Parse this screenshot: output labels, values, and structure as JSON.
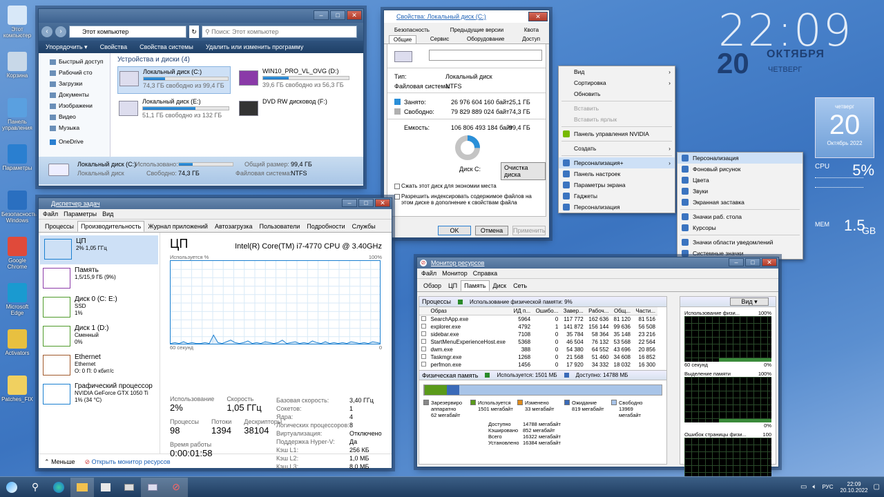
{
  "desktop": {
    "icons": [
      "Этот компьютер",
      "Корзина",
      "Панель управления",
      "Параметры",
      "Безопасность Windows",
      "Google Chrome",
      "Microsoft Edge",
      "Activators",
      "Patches_FIX"
    ]
  },
  "clock": {
    "time": "22:09",
    "day": "20",
    "month": "ОКТЯБРЯ",
    "weekday": "ЧЕТВЕРГ"
  },
  "calendar": {
    "weekday": "четверг",
    "day": "20",
    "month": "Октябрь 2022"
  },
  "gadget": {
    "cpu_label": "CPU",
    "cpu_value": "5%",
    "mem_label": "МЕМ",
    "mem_value": "1.5",
    "mem_unit": "GB"
  },
  "explorer": {
    "address": "Этот компьютер",
    "search_placeholder": "Поиск: Этот компьютер",
    "toolbar": [
      "Упорядочить ▾",
      "Свойства",
      "Свойства системы",
      "Удалить или изменить программу"
    ],
    "nav": [
      "Быстрый доступ",
      "Рабочий сто",
      "Загрузки",
      "Документы",
      "Изображени",
      "Видео",
      "Музыка",
      "OneDrive"
    ],
    "group": "Устройства и диски (4)",
    "drives": [
      {
        "name": "Локальный диск (C:)",
        "free": "74,3 ГБ свободно из 99,4 ГБ",
        "fill": 0.25
      },
      {
        "name": "WIN10_PRO_VL_OVG (D:)",
        "free": "39,6 ГБ свободно из 56,3 ГБ",
        "fill": 0.3
      },
      {
        "name": "Локальный диск (E:)",
        "free": "51,1 ГБ свободно из 132 ГБ",
        "fill": 0.61
      },
      {
        "name": "DVD RW дисковод (F:)",
        "free": "",
        "fill": 0
      }
    ],
    "details": {
      "name": "Локальный диск (C:)",
      "used_label": "Использовано:",
      "free_label": "Свободно:",
      "free": "74,3 ГБ",
      "total_label": "Общий размер:",
      "total": "99,4 ГБ",
      "fs_label": "Файловая система:",
      "fs": "NTFS",
      "kind": "Локальный диск"
    }
  },
  "props": {
    "title": "Свойства: Локальный диск (C:)",
    "tabs_top": [
      "Безопасность",
      "Предыдущие версии",
      "Квота"
    ],
    "tabs_bottom": [
      "Общие",
      "Сервис",
      "Оборудование",
      "Доступ"
    ],
    "type_label": "Тип:",
    "type": "Локальный диск",
    "fs_label": "Файловая система:",
    "fs": "NTFS",
    "used_label": "Занято:",
    "used_bytes": "26 976 604 160 байт",
    "used_gb": "25,1 ГБ",
    "free_label": "Свободно:",
    "free_bytes": "79 829 889 024 байт",
    "free_gb": "74,3 ГБ",
    "cap_label": "Емкость:",
    "cap_bytes": "106 806 493 184 байт",
    "cap_gb": "99,4 ГБ",
    "disk_label": "Диск C:",
    "cleanup": "Очистка диска",
    "compress": "Сжать этот диск для экономии места",
    "index": "Разрешить индексировать содержимое файлов на этом диске в дополнение к свойствам файла",
    "ok": "OK",
    "cancel": "Отмена",
    "apply": "Применить",
    "used_fraction": 0.253
  },
  "ctxmenu": {
    "items": [
      "Вид",
      "Сортировка",
      "Обновить",
      "Вставить",
      "Вставить ярлык",
      "Панель управления NVIDIA",
      "Создать",
      "Персонализация+",
      "Панель настроек",
      "Параметры экрана",
      "Гаджеты",
      "Персонализация"
    ],
    "sub": [
      "Персонализация",
      "Фоновый рисунок",
      "Цвета",
      "Звуки",
      "Экранная заставка",
      "Значки раб. стола",
      "Курсоры",
      "Значки области уведомлений",
      "Системные значки"
    ]
  },
  "taskmgr": {
    "title": "Диспетчер задач",
    "menu": [
      "Файл",
      "Параметры",
      "Вид"
    ],
    "tabs": [
      "Процессы",
      "Производительность",
      "Журнал приложений",
      "Автозагрузка",
      "Пользователи",
      "Подробности",
      "Службы"
    ],
    "side": [
      {
        "name": "ЦП",
        "sub": "2% 1,05 ГГц",
        "color": "#1a7fd0"
      },
      {
        "name": "Память",
        "sub": "1,5/15,9 ГБ (9%)",
        "color": "#8b3aa8"
      },
      {
        "name": "Диск 0 (C: E:)",
        "sub": "SSD\n1%",
        "color": "#4e9a2a"
      },
      {
        "name": "Диск 1 (D:)",
        "sub": "Сменный\n0%",
        "color": "#4e9a2a"
      },
      {
        "name": "Ethernet",
        "sub": "Ethernet\nО: 0 П: 0 кбит/с",
        "color": "#a0582a"
      },
      {
        "name": "Графический процессор",
        "sub": "NVIDIA GeForce GTX 1050 Ti\n1% (34 °C)",
        "color": "#1a7fd0"
      }
    ],
    "cpu_title": "ЦП",
    "cpu_model": "Intel(R) Core(TM) i7-4770 CPU @ 3.40GHz",
    "graph_label": "Используется %",
    "graph_max": "100%",
    "graph_time": "60 секунд",
    "graph_min": "0",
    "stats": {
      "usage_label": "Использование",
      "usage": "2%",
      "speed_label": "Скорость",
      "speed": "1,05 ГГц",
      "proc_label": "Процессы",
      "proc": "98",
      "threads_label": "Потоки",
      "threads": "1394",
      "handles_label": "Дескрипторы",
      "handles": "38104",
      "uptime_label": "Время работы",
      "uptime": "0:00:01:58"
    },
    "info": [
      [
        "Базовая скорость:",
        "3,40 ГГц"
      ],
      [
        "Сокетов:",
        "1"
      ],
      [
        "Ядра:",
        "4"
      ],
      [
        "Логических процессоров:",
        "8"
      ],
      [
        "Виртуализация:",
        "Отключено"
      ],
      [
        "Поддержка Hyper-V:",
        "Да"
      ],
      [
        "Кэш L1:",
        "256 КБ"
      ],
      [
        "Кэш L2:",
        "1,0 МБ"
      ],
      [
        "Кэш L3:",
        "8,0 МБ"
      ]
    ],
    "less": "Меньше",
    "open_monitor": "Открыть монитор ресурсов",
    "cpu_points": [
      2,
      3,
      2,
      4,
      2,
      3,
      2,
      2,
      3,
      2,
      12,
      3,
      2,
      4,
      6,
      3,
      2,
      3,
      5,
      2,
      3,
      2,
      4,
      3,
      2,
      3,
      6,
      2,
      3,
      4,
      2,
      3,
      2,
      5,
      3,
      2,
      4,
      2,
      3,
      2,
      3,
      2,
      4,
      3,
      2,
      3,
      2,
      4,
      3,
      2
    ]
  },
  "resmon": {
    "title": "Монитор ресурсов",
    "menu": [
      "Файл",
      "Монитор",
      "Справка"
    ],
    "tabs": [
      "Обзор",
      "ЦП",
      "Память",
      "Диск",
      "Сеть"
    ],
    "proc_header": "Процессы",
    "phys_usage": "Использование физической памяти: 9%",
    "cols": [
      "Образ",
      "ИД п...",
      "Ошибо...",
      "Завер...",
      "Рабоч...",
      "Общ...",
      "Части..."
    ],
    "rows": [
      [
        "SearchApp.exe",
        "5964",
        "0",
        "117 772",
        "162 636",
        "81 120",
        "81 516"
      ],
      [
        "explorer.exe",
        "4792",
        "1",
        "141 872",
        "156 144",
        "99 636",
        "56 508"
      ],
      [
        "sidebar.exe",
        "7108",
        "0",
        "35 784",
        "58 364",
        "35 148",
        "23 216"
      ],
      [
        "StartMenuExperienceHost.exe",
        "5368",
        "0",
        "46 504",
        "76 132",
        "53 568",
        "22 564"
      ],
      [
        "dwm.exe",
        "388",
        "0",
        "54 380",
        "64 552",
        "43 696",
        "20 856"
      ],
      [
        "Taskmgr.exe",
        "1268",
        "0",
        "21 568",
        "51 460",
        "34 608",
        "16 852"
      ],
      [
        "perfmon.exe",
        "1456",
        "0",
        "17 920",
        "34 332",
        "18 032",
        "16 300"
      ]
    ],
    "phys_header": "Физическая память",
    "used_mb": "Используется: 1501 МБ",
    "avail_mb": "Доступно: 14788 МБ",
    "legend": [
      {
        "name": "Зарезервиро аппаратно",
        "val": "62 мегабайт",
        "color": "#888"
      },
      {
        "name": "Используется",
        "val": "1501 мегабайт",
        "color": "#5a9a1a"
      },
      {
        "name": "Изменено",
        "val": "33 мегабайт",
        "color": "#e08c1a"
      },
      {
        "name": "Ожидание",
        "val": "819 мегабайт",
        "color": "#3a6ab8"
      },
      {
        "name": "Свободно",
        "val": "13969 мегабайт",
        "color": "#a8c4e8"
      }
    ],
    "summary": [
      [
        "Доступно",
        "14788 мегабайт"
      ],
      [
        "Кэшировано",
        "852 мегабайт"
      ],
      [
        "Всего",
        "16322 мегабайт"
      ],
      [
        "Установлено",
        "16384 мегабайт"
      ]
    ],
    "view": "Вид",
    "graphs": [
      {
        "top": "Использование физи...",
        "pct": "100%",
        "bottom": "60 секунд",
        "bpct": "0%"
      },
      {
        "top": "Выделение памяти",
        "pct": "100%",
        "bottom": "",
        "bpct": "0%"
      },
      {
        "top": "Ошибок страницы физи...",
        "pct": "100",
        "bottom": "",
        "bpct": ""
      }
    ]
  },
  "taskbar": {
    "lang": "РУС",
    "time": "22:09",
    "date": "20.10.2022"
  }
}
